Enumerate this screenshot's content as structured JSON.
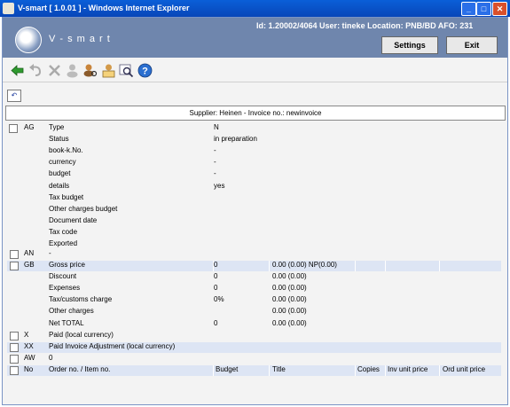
{
  "window": {
    "title": "V-smart [ 1.0.01 ] - Windows Internet Explorer",
    "controls": [
      "minimize",
      "maximize",
      "close"
    ]
  },
  "header": {
    "brand": "V - s m a r t",
    "info": "Id: 1.20002/4064   User: tineke   Location: PNB/BD   AFO: 231",
    "settings_label": "Settings",
    "exit_label": "Exit"
  },
  "toolbar": {
    "icons": [
      "back-arrow-icon",
      "undo-icon",
      "delete-icon",
      "person-icon",
      "user-search-icon",
      "user-card-icon",
      "zoom-icon",
      "help-icon"
    ]
  },
  "supplier_line": "Supplier: Heinen - Invoice no.: newinvoice",
  "ag": {
    "code": "AG",
    "fields": [
      {
        "label": "Type",
        "value": "N"
      },
      {
        "label": "Status",
        "value": "in preparation"
      },
      {
        "label": "book-k.No.",
        "value": "-"
      },
      {
        "label": "currency",
        "value": "-"
      },
      {
        "label": "budget",
        "value": "-"
      },
      {
        "label": "details",
        "value": "yes"
      },
      {
        "label": "Tax budget",
        "value": ""
      },
      {
        "label": "Other charges budget",
        "value": ""
      },
      {
        "label": "Document date",
        "value": ""
      },
      {
        "label": "Tax code",
        "value": ""
      },
      {
        "label": "Exported",
        "value": ""
      }
    ]
  },
  "an": {
    "code": "AN",
    "value": "-"
  },
  "gb": {
    "code": "GB",
    "rows": [
      {
        "label": "Gross price",
        "qty": "0",
        "amount": "0.00 (0.00) NP(0.00)"
      },
      {
        "label": "Discount",
        "qty": "0",
        "amount": "0.00 (0.00)"
      },
      {
        "label": "Expenses",
        "qty": "0",
        "amount": "0.00 (0.00)"
      },
      {
        "label": "Tax/customs charge",
        "qty": "0%",
        "amount": "0.00 (0.00)"
      },
      {
        "label": "Other charges",
        "qty": "",
        "amount": "0.00 (0.00)"
      },
      {
        "label": "Net TOTAL",
        "qty": "0",
        "amount": "0.00 (0.00)"
      }
    ]
  },
  "x": {
    "code": "X",
    "label": "Paid (local currency)"
  },
  "xx": {
    "code": "XX",
    "label": "Paid Invoice Adjustment (local currency)"
  },
  "aw": {
    "code": "AW",
    "value": "0"
  },
  "orders": {
    "code": "No",
    "columns": [
      "Order no. / Item no.",
      "Budget",
      "Title",
      "Copies",
      "Inv unit price",
      "Ord unit price"
    ]
  },
  "colors": {
    "header_bg": "#6f86ad",
    "titlebar": "#0a5fd8",
    "highlight_row": "#dde5f4"
  }
}
